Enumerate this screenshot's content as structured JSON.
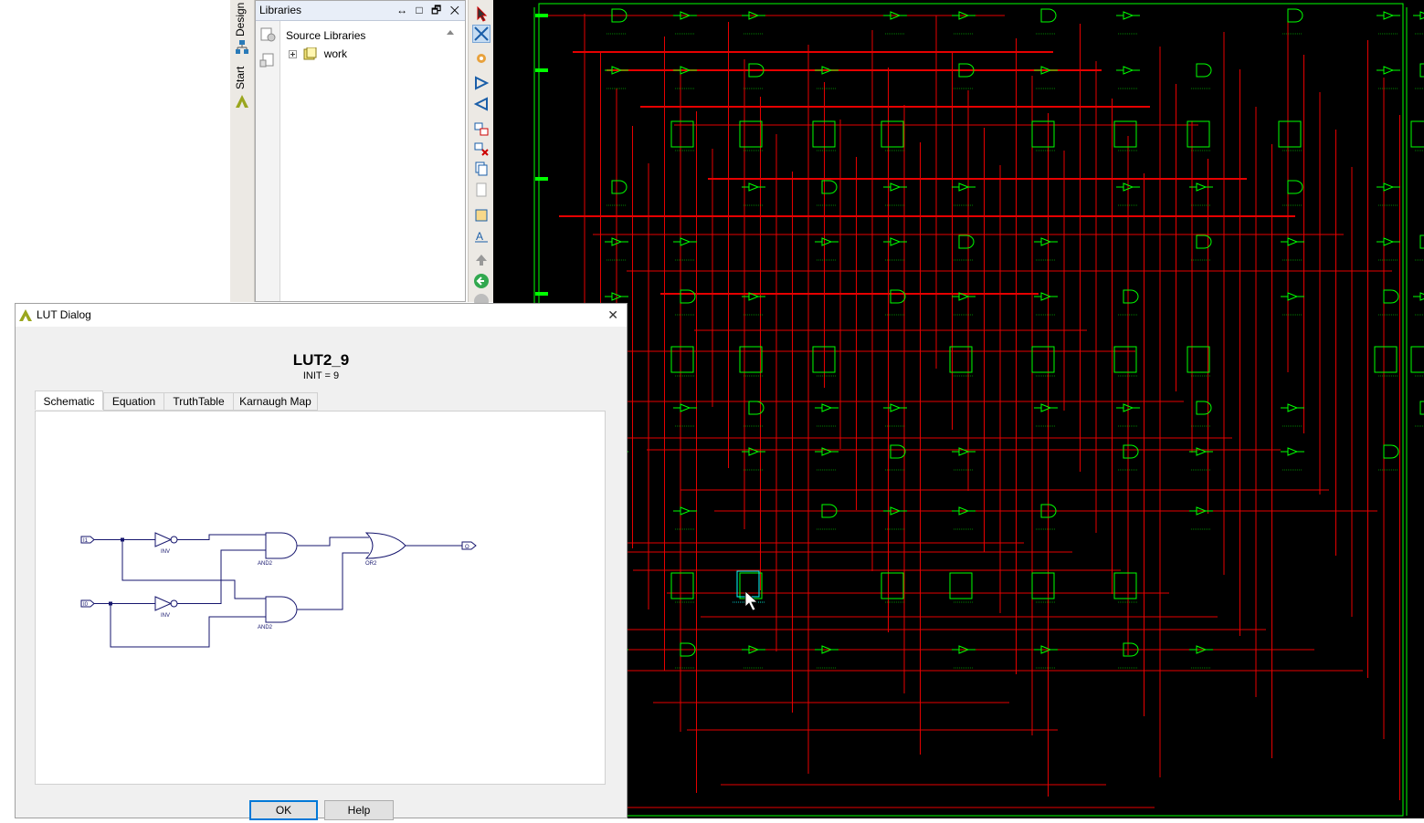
{
  "side_tabs": [
    "Design",
    "Start"
  ],
  "libraries": {
    "title": "Libraries",
    "window_controls": [
      "↔",
      "□",
      "🗗",
      "✕"
    ],
    "root_label": "Source Libraries",
    "child_label": "work"
  },
  "dialog": {
    "title": "LUT Dialog",
    "close_glyph": "✕",
    "heading": "LUT2_9",
    "subheading": "INIT = 9",
    "tabs": [
      "Schematic",
      "Equation",
      "TruthTable",
      "Karnaugh Map"
    ],
    "ok_label": "OK",
    "help_label": "Help"
  },
  "lut_schematic": {
    "in1": "I1",
    "in0": "I0",
    "out": "O",
    "inv": "INV",
    "and2": "AND2",
    "or2": "OR2"
  },
  "colors": {
    "schematic_bg": "#000000",
    "cell": "#00ff00",
    "net": "#e60000",
    "selected": "#00ffff",
    "lut_wire": "#16166e"
  }
}
